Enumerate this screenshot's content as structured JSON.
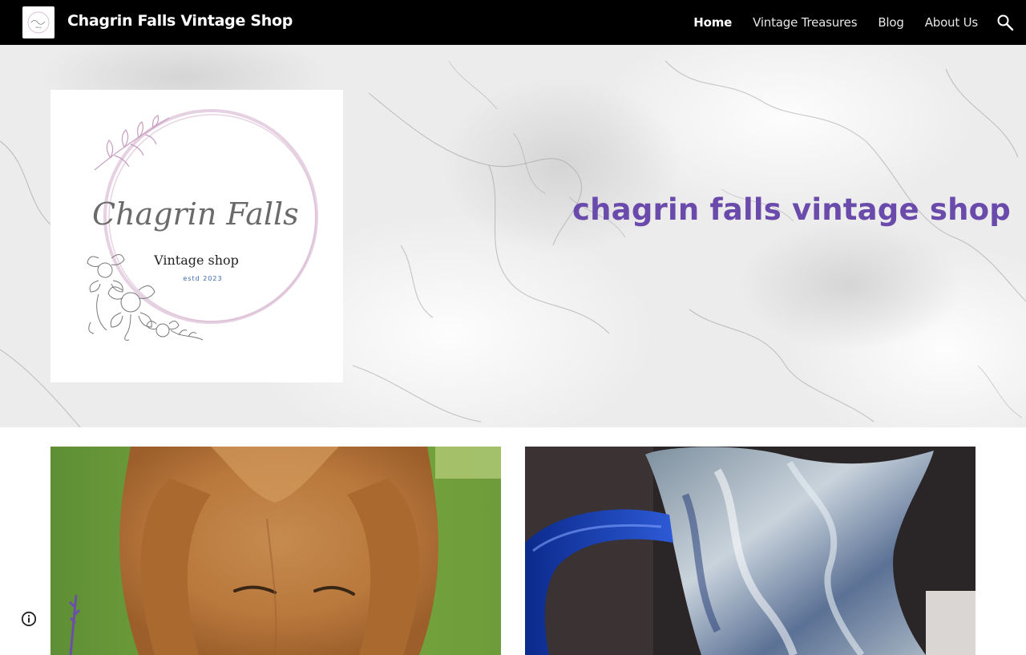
{
  "header": {
    "site_title": "Chagrin Falls Vintage Shop",
    "logo_icon": "site-logo-thumbnail",
    "search_icon": "search-icon",
    "nav": [
      {
        "label": "Home",
        "active": true
      },
      {
        "label": "Vintage Treasures",
        "active": false
      },
      {
        "label": "Blog",
        "active": false
      },
      {
        "label": "About Us",
        "active": false
      }
    ]
  },
  "hero": {
    "heading": "chagrin falls vintage shop",
    "heading_color": "#6a4bab",
    "logo": {
      "script_text": "Chagrin Falls",
      "subtitle": "Vintage shop",
      "established": "estd 2023"
    }
  },
  "photos": [
    {
      "subject": "golden retriever dog"
    },
    {
      "subject": "blue and white art glass pitcher"
    }
  ],
  "footer": {
    "info_icon": "info-icon"
  }
}
